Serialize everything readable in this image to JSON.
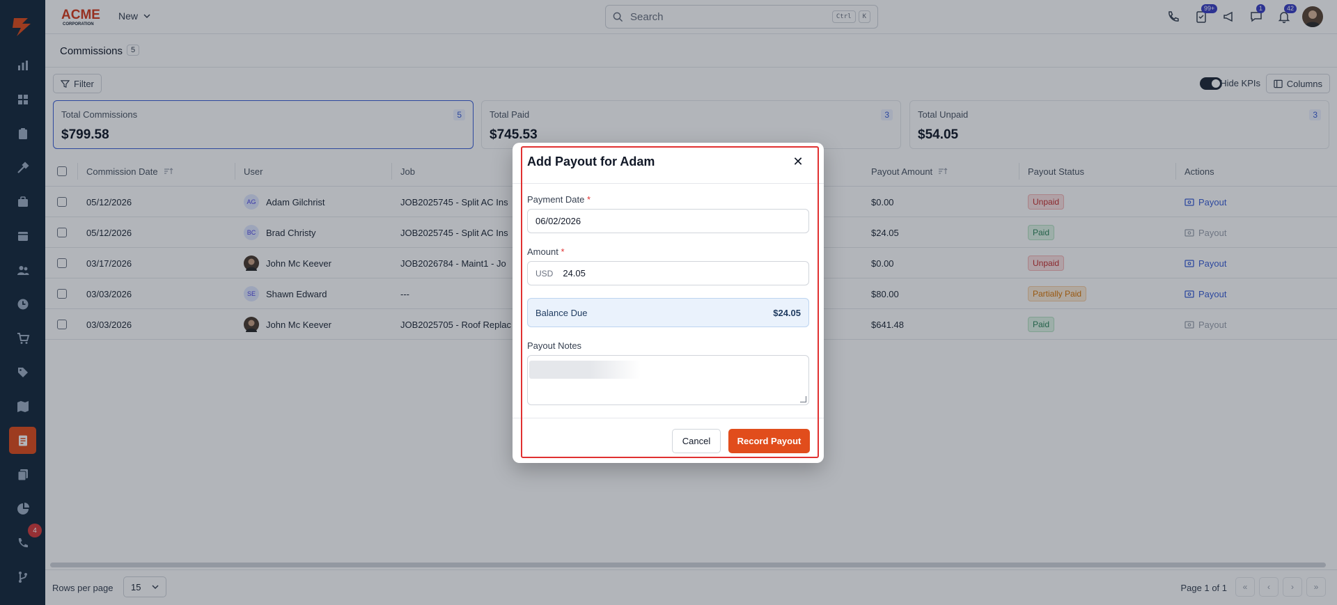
{
  "app": {
    "brand": "ACME CORPORATION",
    "new_menu": "New",
    "search_placeholder": "Search",
    "search_shortcut": [
      "Ctrl",
      "K"
    ],
    "badges": {
      "tasks": "99+",
      "chat": "1",
      "notifications": "42",
      "sidebar_phone": "4"
    }
  },
  "page": {
    "title": "Commissions",
    "count": "5",
    "filter_label": "Filter",
    "hide_kpis_label": "Hide KPIs",
    "hide_kpis_on": true,
    "columns_label": "Columns"
  },
  "kpis": [
    {
      "label": "Total Commissions",
      "value": "$799.58",
      "count": "5"
    },
    {
      "label": "Total Paid",
      "value": "$745.53",
      "count": "3"
    },
    {
      "label": "Total Unpaid",
      "value": "$54.05",
      "count": "3"
    }
  ],
  "table": {
    "headers": {
      "commission_date": "Commission Date",
      "user": "User",
      "job": "Job",
      "payout_amount": "Payout Amount",
      "payout_status": "Payout Status",
      "actions": "Actions"
    },
    "rows": [
      {
        "date": "05/12/2026",
        "initials": "AG",
        "user": "Adam Gilchrist",
        "job": "JOB2025745 - Split AC Ins",
        "amount": "$0.00",
        "status": "Unpaid",
        "action": "Payout"
      },
      {
        "date": "05/12/2026",
        "initials": "BC",
        "user": "Brad Christy",
        "job": "JOB2025745 - Split AC Ins",
        "amount": "$24.05",
        "status": "Paid",
        "action": "Payout"
      },
      {
        "date": "03/17/2026",
        "initials": "",
        "user": "John Mc Keever",
        "job": "JOB2026784 - Maint1 - Jo",
        "amount": "$0.00",
        "status": "Unpaid",
        "action": "Payout"
      },
      {
        "date": "03/03/2026",
        "initials": "SE",
        "user": "Shawn Edward",
        "job": "---",
        "amount": "$80.00",
        "status": "Partially Paid",
        "action": "Payout"
      },
      {
        "date": "03/03/2026",
        "initials": "",
        "user": "John Mc Keever",
        "job": "JOB2025705 - Roof Replac",
        "amount": "$641.48",
        "status": "Paid",
        "action": "Payout"
      }
    ]
  },
  "footer": {
    "rows_per_page_label": "Rows per page",
    "rows_per_page_value": "15",
    "page_info": "Page 1 of 1"
  },
  "modal": {
    "title": "Add Payout for Adam",
    "payment_date_label": "Payment Date",
    "payment_date_value": "06/02/2026",
    "amount_label": "Amount",
    "amount_currency": "USD",
    "amount_value": "24.05",
    "balance_due_label": "Balance Due",
    "balance_due_value": "$24.05",
    "notes_label": "Payout Notes",
    "required_mark": "*",
    "cancel_label": "Cancel",
    "submit_label": "Record Payout"
  },
  "colors": {
    "sidebar_bg": "#172a3d",
    "accent": "#e14d1c",
    "highlight_outline": "#e03131",
    "link": "#3b5fd6"
  }
}
